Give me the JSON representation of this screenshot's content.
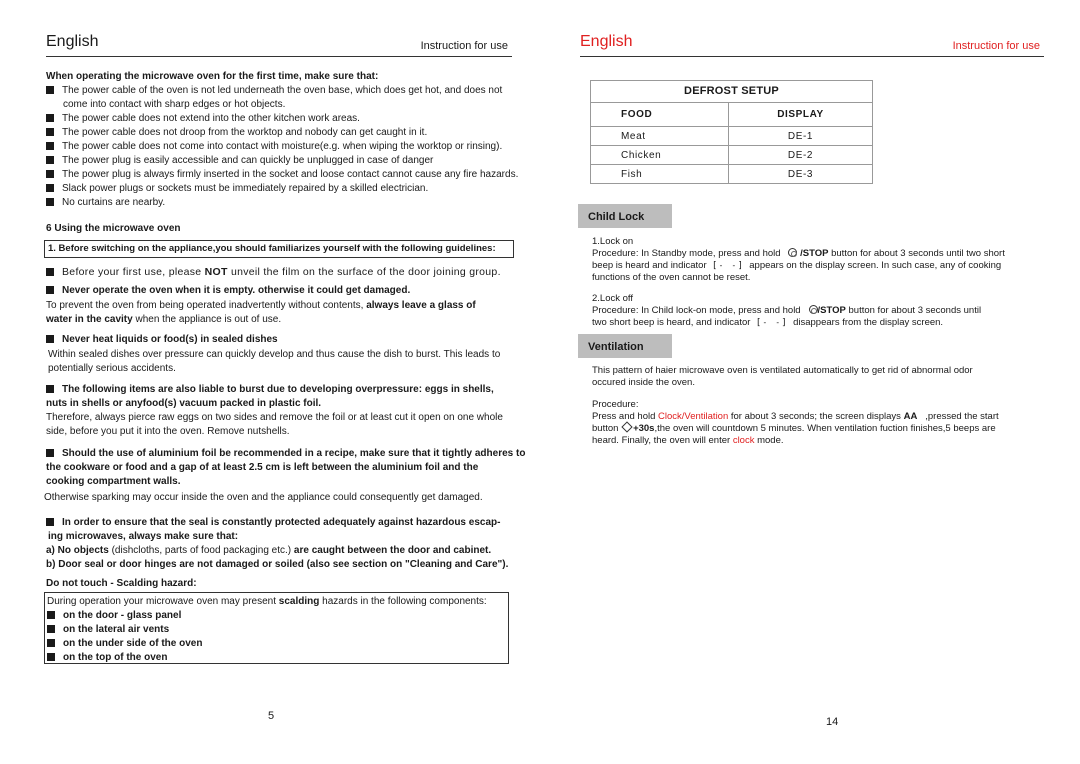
{
  "left_page": {
    "header": {
      "language": "English",
      "subtitle": "Instruction for use"
    },
    "first_time": {
      "heading": "When operating the microwave oven for the first time, make sure that:",
      "items": [
        "The power cable of the oven is not led underneath the oven base, which does get hot, and does not",
        "come into contact with  sharp edges or hot objects.",
        "The power cable  does not extend into the other  kitchen work areas.",
        "The power cable does  not droop from the worktop  and nobody can get caught in it.",
        "The power cable does not come into contact with moisture(e.g. when wiping the worktop or rinsing).",
        "The power plug  is easily accessible and can quickly  be unplugged in case  of danger",
        "The power plug is always firmly inserted in the socket and loose contact  cannot cause any fire hazards.",
        "Slack power plugs  or sockets must be immediately  repaired by a skilled  electrician.",
        "No curtains are  nearby."
      ]
    },
    "section6": {
      "heading": "6 Using the microwave oven",
      "guideline_box": "1. Before switching on the  appliance,you should familiarizes yourself with  the following guidelines:",
      "film_note": {
        "pre": "Before your first use, please ",
        "bold": "NOT",
        "post": " unveil the film on the surface of the door joining group."
      },
      "empty_heading": "Never operate the oven when it is empty. otherwise it could get damaged.",
      "empty_text": {
        "pre": "To prevent the oven from being  operated inadvertently without contents, ",
        "bold1": "always leave a glass of",
        "bold2": "water in the cavity",
        "post": " when the appliance is out of use."
      },
      "sealed_heading": "Never heat liquids or food(s) in sealed dishes",
      "sealed_text_1": "Within sealed dishes over pressure can quickly develop and thus cause the dish to burst. This leads to",
      "sealed_text_2": "potentially serious accidents.",
      "burst_heading_1": "The following items are also liable to burst due to developing overpressure: eggs in shells,",
      "burst_heading_2": "nuts in shells or anyfood(s) vacuum packed in plastic foil.",
      "burst_text_1": "Therefore, always pierce raw eggs on two sides and remove the foil or at least cut it  open on one whole",
      "burst_text_2": "side, before you  put it into the oven.  Remove nutshells.",
      "foil_heading_1": "Should the use of aluminium  foil be recommended in a  recipe, make sure that it  tightly adheres to",
      "foil_heading_2": "the cookware or  food and  a gap of  at least 2.5 cm is left between  the aluminium foil  and the",
      "foil_heading_3": "cooking compartment walls.",
      "foil_text": "Otherwise sparking may occur inside the oven and the appliance could consequently get damaged.",
      "seal_heading_1": "In order to ensure that the seal is constantly protected adequately against hazardous escap-",
      "seal_heading_2": "ing microwaves,  always make sure that:",
      "seal_a": {
        "pre": "a)  No objects",
        "normal": " (dishcloths, parts of food  packaging etc.)",
        "post": " are caught between the door and cabinet."
      },
      "seal_b": "b)  Door seal or door hinges are not damaged or  soiled (also see section on \"Cleaning  and Care\").",
      "scald_heading": "Do not touch - Scalding hazard:",
      "scald_intro": {
        "pre": "During operation your microwave oven may present ",
        "bold": "scalding",
        "post": " hazards in the following components:"
      },
      "scald_items": [
        "on the door - glass panel",
        "on the lateral air vents",
        "on the under side of the oven",
        "on the top of the oven"
      ]
    },
    "page_number": "5"
  },
  "right_page": {
    "header": {
      "language": "English",
      "subtitle": "Instruction for use"
    },
    "defrost": {
      "title": "DEFROST SETUP",
      "columns": [
        "FOOD",
        "DISPLAY"
      ],
      "rows": [
        {
          "food": "Meat",
          "display": "DE-1"
        },
        {
          "food": "Chicken",
          "display": "DE-2"
        },
        {
          "food": "Fish",
          "display": "DE-3"
        }
      ]
    },
    "child_lock": {
      "title": "Child Lock",
      "lock_on_label": "1.Lock on",
      "lock_on_1a": "Procedure: In Standby mode, press and hold ",
      "stop_label": "/STOP",
      "lock_on_1b": " button for about 3 seconds until two short",
      "lock_on_2a": "beep is heard and indicator ",
      "lock_indicator": "[˗ ˗]",
      "lock_on_2b": " appears on the display screen. In such case, any of cooking",
      "lock_on_3": "functions of the oven cannot be reset.",
      "lock_off_label": "2.Lock off",
      "lock_off_1a": "Procedure: In Child lock-on mode, press and hold ",
      "lock_off_1b": " button for about 3 seconds until",
      "lock_off_2a": "two short beep is heard, and indicator ",
      "lock_off_2b": " disappears from the display screen."
    },
    "ventilation": {
      "title": "Ventilation",
      "desc_1": "This pattern of haier microwave oven is ventilated automatically to get rid of abnormal odor",
      "desc_2": "occured inside the oven.",
      "procedure_label": "Procedure:",
      "p1_pre": "Press and hold ",
      "p1_red": "Clock/Ventilation",
      "p1_mid": " for about 3 seconds; the screen displays  ",
      "p1_bold": "AA",
      "p1_post": "   ,pressed the start",
      "p2_pre": "button ",
      "p2_bold": "+30s",
      "p2_post": ",the oven will countdown 5 minutes. When ventilation fuction finishes,5 beeps are",
      "p3_pre": "heard. Finally, the oven will enter ",
      "p3_red": "clock",
      "p3_post": " mode."
    },
    "page_number": "14"
  },
  "colors": {
    "accent_red": "#e02020",
    "section_tab_gray": "#bdbdbd",
    "text": "#1a1a1a"
  }
}
